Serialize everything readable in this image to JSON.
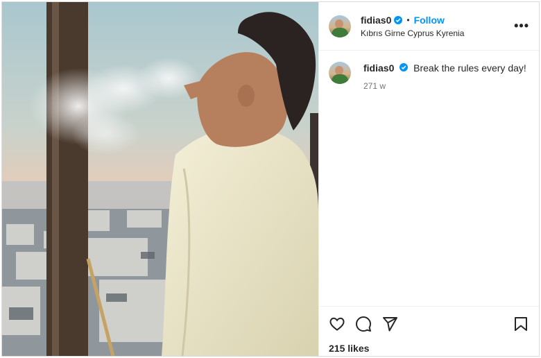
{
  "post": {
    "username": "fidias0",
    "follow_label": "Follow",
    "separator": "•",
    "location": "Kıbrıs Girne Cyprus Kyrenia",
    "more_label": "•••",
    "caption": {
      "username": "fidias0",
      "text": "Break the rules every day!",
      "time": "271 w"
    },
    "likes": "215 likes"
  },
  "colors": {
    "accent": "#0095f6",
    "verified": "#0095f6",
    "text": "#262626",
    "muted": "#737373"
  },
  "icons": {
    "like": "heart-icon",
    "comment": "comment-icon",
    "share": "send-icon",
    "save": "bookmark-icon",
    "verified": "verified-badge-icon"
  }
}
